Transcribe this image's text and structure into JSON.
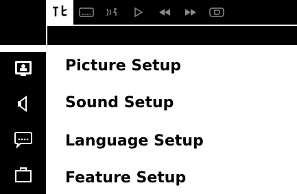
{
  "toolbar": {
    "icons": [
      {
        "name": "settings-icon",
        "active": true
      },
      {
        "name": "subtitle-icon",
        "active": false
      },
      {
        "name": "audio-signal-icon",
        "active": false
      },
      {
        "name": "play-icon",
        "active": false
      },
      {
        "name": "rewind-icon",
        "active": false
      },
      {
        "name": "fast-forward-icon",
        "active": false
      },
      {
        "name": "disc-icon",
        "active": false
      }
    ]
  },
  "menu": {
    "items": [
      {
        "label": "Picture Setup",
        "icon": "picture-setup-icon"
      },
      {
        "label": "Sound Setup",
        "icon": "sound-setup-icon"
      },
      {
        "label": "Language Setup",
        "icon": "language-setup-icon"
      },
      {
        "label": "Feature Setup",
        "icon": "feature-setup-icon"
      }
    ]
  },
  "colors": {
    "background": "#ffffff",
    "panel": "#000000",
    "icon_dim": "#8a8a8a",
    "text": "#000000"
  }
}
